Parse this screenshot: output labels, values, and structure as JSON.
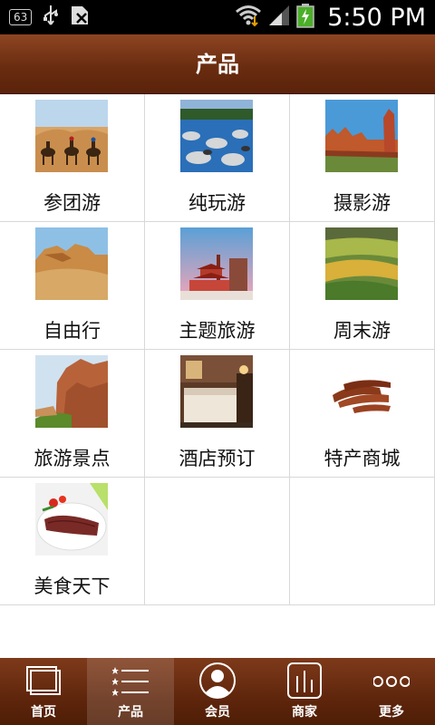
{
  "status_bar": {
    "badge": "63",
    "time": "5:50 PM",
    "icons": [
      "usb-icon",
      "sim-icon",
      "wifi-icon",
      "signal-icon",
      "battery-charging-icon"
    ]
  },
  "header": {
    "title": "产品"
  },
  "grid": {
    "items": [
      {
        "label": "参团游",
        "icon": "camel-desert-photo"
      },
      {
        "label": "纯玩游",
        "icon": "river-rocks-photo"
      },
      {
        "label": "摄影游",
        "icon": "red-rock-cliffs-photo"
      },
      {
        "label": "自由行",
        "icon": "sandstone-formation-photo"
      },
      {
        "label": "主题旅游",
        "icon": "pavilion-photo"
      },
      {
        "label": "周末游",
        "icon": "green-valley-photo"
      },
      {
        "label": "旅游景点",
        "icon": "canyon-cliff-photo"
      },
      {
        "label": "酒店预订",
        "icon": "hotel-room-photo"
      },
      {
        "label": "特产商城",
        "icon": "dried-meat-photo"
      },
      {
        "label": "美食天下",
        "icon": "sliced-meat-dish-photo"
      }
    ]
  },
  "bottom_nav": {
    "items": [
      {
        "label": "首页",
        "icon": "home-icon",
        "active": false
      },
      {
        "label": "产品",
        "icon": "list-icon",
        "active": true
      },
      {
        "label": "会员",
        "icon": "member-icon",
        "active": false
      },
      {
        "label": "商家",
        "icon": "merchant-icon",
        "active": false
      },
      {
        "label": "更多",
        "icon": "more-icon",
        "active": false
      }
    ]
  }
}
